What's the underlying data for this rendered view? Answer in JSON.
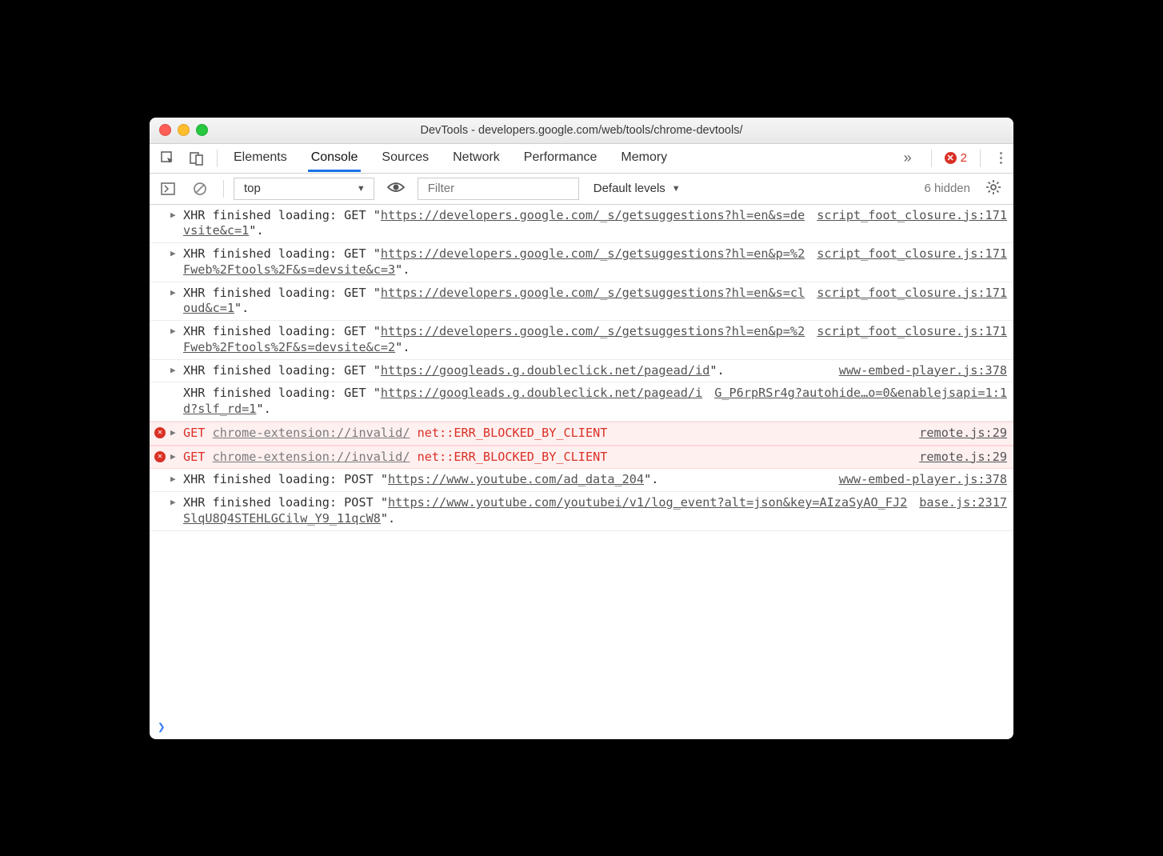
{
  "window_title": "DevTools - developers.google.com/web/tools/chrome-devtools/",
  "tabs": {
    "t0": "Elements",
    "t1": "Console",
    "t2": "Sources",
    "t3": "Network",
    "t4": "Performance",
    "t5": "Memory"
  },
  "error_count": "2",
  "toolbar": {
    "context": "top",
    "filter_placeholder": "Filter",
    "levels": "Default levels",
    "hidden": "6 hidden"
  },
  "logs": [
    {
      "type": "xhr",
      "method": "GET",
      "url": "https://developers.google.com/_s/getsuggestions?hl=en&s=devsite&c=1",
      "src": "script_foot_closure.js:171"
    },
    {
      "type": "xhr",
      "method": "GET",
      "url": "https://developers.google.com/_s/getsuggestions?hl=en&p=%2Fweb%2Ftools%2F&s=devsite&c=3",
      "src": "script_foot_closure.js:171"
    },
    {
      "type": "xhr",
      "method": "GET",
      "url": "https://developers.google.com/_s/getsuggestions?hl=en&s=cloud&c=1",
      "src": "script_foot_closure.js:171"
    },
    {
      "type": "xhr",
      "method": "GET",
      "url": "https://developers.google.com/_s/getsuggestions?hl=en&p=%2Fweb%2Ftools%2F&s=devsite&c=2",
      "src": "script_foot_closure.js:171"
    },
    {
      "type": "xhr",
      "method": "GET",
      "url": "https://googleads.g.doubleclick.net/pagead/id",
      "src": "www-embed-player.js:378"
    },
    {
      "type": "xhr_nodisclose",
      "method": "GET",
      "url": "https://googleads.g.doubleclick.net/pagead/id?slf_rd=1",
      "src": "G_P6rpRSr4g?autohide…o=0&enablejsapi=1:1"
    },
    {
      "type": "err",
      "method": "GET",
      "url": "chrome-extension://invalid/",
      "errmsg": "net::ERR_BLOCKED_BY_CLIENT",
      "src": "remote.js:29"
    },
    {
      "type": "err",
      "method": "GET",
      "url": "chrome-extension://invalid/",
      "errmsg": "net::ERR_BLOCKED_BY_CLIENT",
      "src": "remote.js:29"
    },
    {
      "type": "xhr",
      "method": "POST",
      "url": "https://www.youtube.com/ad_data_204",
      "src": "www-embed-player.js:378"
    },
    {
      "type": "xhr",
      "method": "POST",
      "url": "https://www.youtube.com/youtubei/v1/log_event?alt=json&key=AIzaSyAO_FJ2SlqU8Q4STEHLGCilw_Y9_11qcW8",
      "src": "base.js:2317"
    }
  ],
  "prompt": "❯"
}
